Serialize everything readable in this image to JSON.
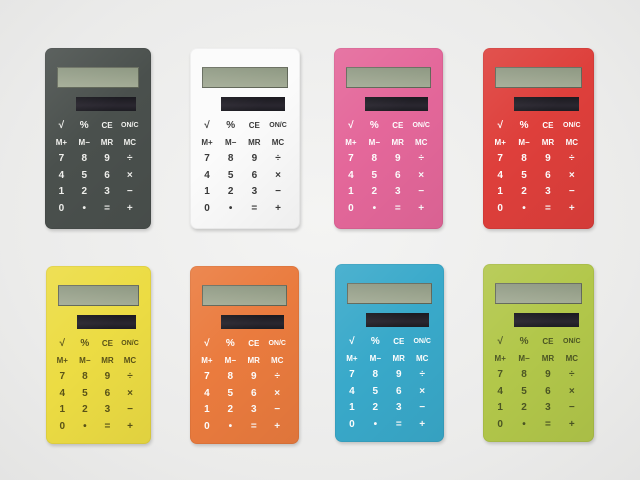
{
  "calculators": [
    {
      "name": "dark-gray",
      "color": "#4a504d",
      "key_color": "#f2f2ef"
    },
    {
      "name": "white",
      "color": "#fbfbfb",
      "key_color": "#3a3a3a"
    },
    {
      "name": "pink",
      "color": "#e4679a",
      "key_color": "#ffffff"
    },
    {
      "name": "red",
      "color": "#de3f3b",
      "key_color": "#ffffff"
    },
    {
      "name": "yellow",
      "color": "#ecdc43",
      "key_color": "#5a5318"
    },
    {
      "name": "orange",
      "color": "#ea7b3e",
      "key_color": "#ffffff"
    },
    {
      "name": "blue",
      "color": "#39a9ca",
      "key_color": "#ffffff"
    },
    {
      "name": "lime-green",
      "color": "#b2c74a",
      "key_color": "#4c5624"
    }
  ],
  "keypad": [
    [
      {
        "label": "√",
        "key": "sqrt"
      },
      {
        "label": "%",
        "key": "percent"
      },
      {
        "label": "CE",
        "key": "ce"
      },
      {
        "label": "ON/C",
        "key": "on-c"
      }
    ],
    [
      {
        "label": "M+",
        "key": "m-plus"
      },
      {
        "label": "M−",
        "key": "m-minus"
      },
      {
        "label": "MR",
        "key": "mr"
      },
      {
        "label": "MC",
        "key": "mc"
      }
    ],
    [
      {
        "label": "7",
        "key": "7"
      },
      {
        "label": "8",
        "key": "8"
      },
      {
        "label": "9",
        "key": "9"
      },
      {
        "label": "÷",
        "key": "divide"
      }
    ],
    [
      {
        "label": "4",
        "key": "4"
      },
      {
        "label": "5",
        "key": "5"
      },
      {
        "label": "6",
        "key": "6"
      },
      {
        "label": "×",
        "key": "multiply"
      }
    ],
    [
      {
        "label": "1",
        "key": "1"
      },
      {
        "label": "2",
        "key": "2"
      },
      {
        "label": "3",
        "key": "3"
      },
      {
        "label": "−",
        "key": "minus"
      }
    ],
    [
      {
        "label": "0",
        "key": "0"
      },
      {
        "label": "•",
        "key": "decimal"
      },
      {
        "label": "=",
        "key": "equals"
      },
      {
        "label": "+",
        "key": "plus"
      }
    ]
  ]
}
